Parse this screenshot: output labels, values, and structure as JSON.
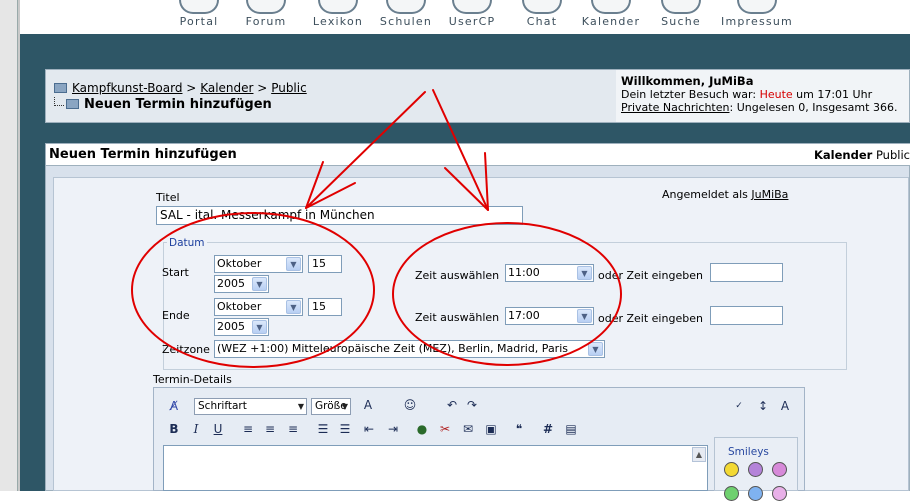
{
  "nav": {
    "items": [
      {
        "label": "Portal",
        "icon": "portal-icon"
      },
      {
        "label": "Forum",
        "icon": "forum-icon"
      },
      {
        "label": "Lexikon",
        "icon": "lexikon-icon"
      },
      {
        "label": "Schulen",
        "icon": "schulen-icon"
      },
      {
        "label": "UserCP",
        "icon": "usercp-icon"
      },
      {
        "label": "Chat",
        "icon": "chat-icon"
      },
      {
        "label": "Kalender",
        "icon": "kalender-icon"
      },
      {
        "label": "Suche",
        "icon": "suche-icon"
      },
      {
        "label": "Impressum",
        "icon": "impressum-icon"
      }
    ]
  },
  "breadcrumb": {
    "board": "Kampfkunst-Board",
    "sep1": ">",
    "calendar": "Kalender",
    "sep2": ">",
    "section": "Public",
    "current": "Neuen Termin hinzufügen"
  },
  "welcome": {
    "greeting": "Willkommen, JuMiBa",
    "last_visit_prefix": "Dein letzter Besuch war:",
    "last_visit_day": "Heute",
    "last_visit_suffix": "um 17:01 Uhr",
    "pm_link": "Private Nachrichten",
    "pm_text": ": Ungelesen 0, Insgesamt 366."
  },
  "panel": {
    "title": "Neuen Termin hinzufügen",
    "right_bold": "Kalender",
    "right_text": "Public"
  },
  "form": {
    "logged_in_prefix": "Angemeldet als",
    "logged_in_user": "JuMiBa",
    "title_label": "Titel",
    "title_value": "SAL - ital. Messerkampf in München",
    "datum_legend": "Datum",
    "start_label": "Start",
    "end_label": "Ende",
    "start_month": "Oktober",
    "start_day": "15",
    "start_year": "2005",
    "end_month": "Oktober",
    "end_day": "15",
    "end_year": "2005",
    "time_select_label": "Zeit auswählen",
    "start_time": "11:00",
    "end_time": "17:00",
    "time_enter_label": "oder Zeit eingeben",
    "start_time_input": "",
    "end_time_input": "",
    "timezone_label": "Zeitzone",
    "timezone_value": "(WEZ +1:00) Mitteleuropäische Zeit (MEZ), Berlin, Madrid, Paris",
    "details_label": "Termin-Details"
  },
  "editor": {
    "font_select": "Schriftart",
    "size_select": "Größe",
    "buttons": [
      "B",
      "I",
      "U"
    ],
    "smileys_label": "Smileys"
  },
  "colors": {
    "teal_background": "#2e5666",
    "annotation_red": "#e00000",
    "heute_red": "#d60000"
  }
}
